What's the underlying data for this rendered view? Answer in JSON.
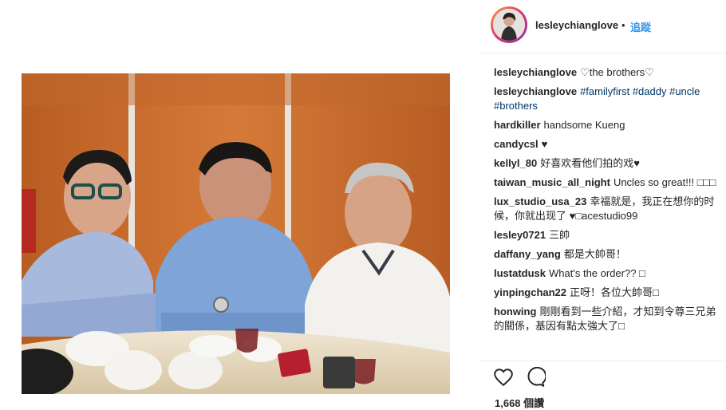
{
  "post": {
    "username": "lesleychianglove",
    "separator": "•",
    "follow_label": "追蹤",
    "likes_text": "1,668 個讚"
  },
  "comments": [
    {
      "user": "lesleychianglove",
      "parts": [
        {
          "t": "♡the brothers♡"
        }
      ]
    },
    {
      "user": "lesleychianglove",
      "parts": [
        {
          "t": "#familyfirst",
          "tag": true
        },
        {
          "t": " "
        },
        {
          "t": "#daddy",
          "tag": true
        },
        {
          "t": " "
        },
        {
          "t": "#uncle",
          "tag": true
        },
        {
          "t": " "
        },
        {
          "t": "#brothers",
          "tag": true
        }
      ]
    },
    {
      "user": "hardkiller",
      "parts": [
        {
          "t": "handsome Kueng"
        }
      ]
    },
    {
      "user": "candycsl",
      "parts": [
        {
          "t": "♥"
        }
      ]
    },
    {
      "user": "kellyl_80",
      "parts": [
        {
          "t": "好喜欢看他们拍的戏♥"
        }
      ]
    },
    {
      "user": "taiwan_music_all_night",
      "parts": [
        {
          "t": "Uncles so great!!! □□□"
        }
      ]
    },
    {
      "user": "lux_studio_usa_23",
      "parts": [
        {
          "t": "幸福就是，我正在想你的时候，你就出现了 ♥□acestudio99"
        }
      ]
    },
    {
      "user": "lesley0721",
      "parts": [
        {
          "t": "三帥"
        }
      ]
    },
    {
      "user": "daffany_yang",
      "parts": [
        {
          "t": "都是大帥哥！"
        }
      ]
    },
    {
      "user": "lustatdusk",
      "parts": [
        {
          "t": "What's the order?? □"
        }
      ]
    },
    {
      "user": "yinpingchan22",
      "parts": [
        {
          "t": "正呀！各位大帥哥□"
        }
      ]
    },
    {
      "user": "honwing",
      "parts": [
        {
          "t": "剛剛看到一些介紹，才知到令尊三兄弟的關係，基因有點太強大了□"
        }
      ]
    }
  ],
  "icons": {
    "like": "heart-icon",
    "comment": "comment-icon",
    "avatar": "avatar"
  },
  "colors": {
    "link": "#003569",
    "follow": "#3897f0",
    "text": "#262626"
  }
}
